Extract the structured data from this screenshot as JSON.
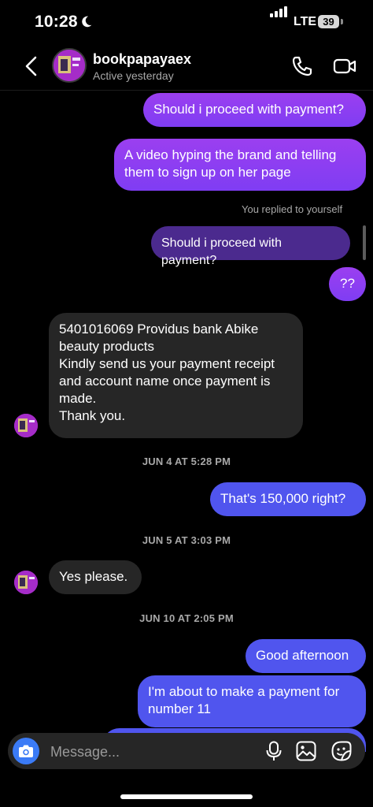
{
  "status_bar": {
    "time": "10:28",
    "network": "LTE",
    "battery": "39"
  },
  "header": {
    "username": "bookpapayaex",
    "active_status": "Active yesterday",
    "icons": [
      "back-chevron-icon",
      "phone-icon",
      "video-camera-icon"
    ]
  },
  "messages": {
    "m1": "Should i proceed with payment?",
    "m2": "A video hyping the brand and telling them to sign up on her page",
    "replied_note": "You replied to yourself",
    "m3_quote": "Should i proceed with payment?",
    "m4": "??",
    "m5_line1": "5401016069 Providus bank Abike beauty products",
    "m5_line2": "Kindly send us your payment receipt and account name once payment is made.",
    "m5_line3": "Thank you.",
    "ts1": "JUN 4 AT 5:28 PM",
    "m6": "That's 150,000 right?",
    "ts2": "JUN 5 AT 3:03 PM",
    "m7": "Yes please.",
    "ts3": "JUN 10 AT 2:05 PM",
    "m8": "Good afternoon",
    "m9": "I'm about to make a payment for number 11"
  },
  "composer": {
    "placeholder": "Message...",
    "icons": [
      "camera-icon",
      "microphone-icon",
      "gallery-icon",
      "sticker-icon"
    ]
  },
  "colors": {
    "outgoing_purple": "#8f3ef2",
    "outgoing_blue": "#5055ee",
    "incoming_gray": "#262626",
    "camera_blue": "#3b7bf6"
  }
}
